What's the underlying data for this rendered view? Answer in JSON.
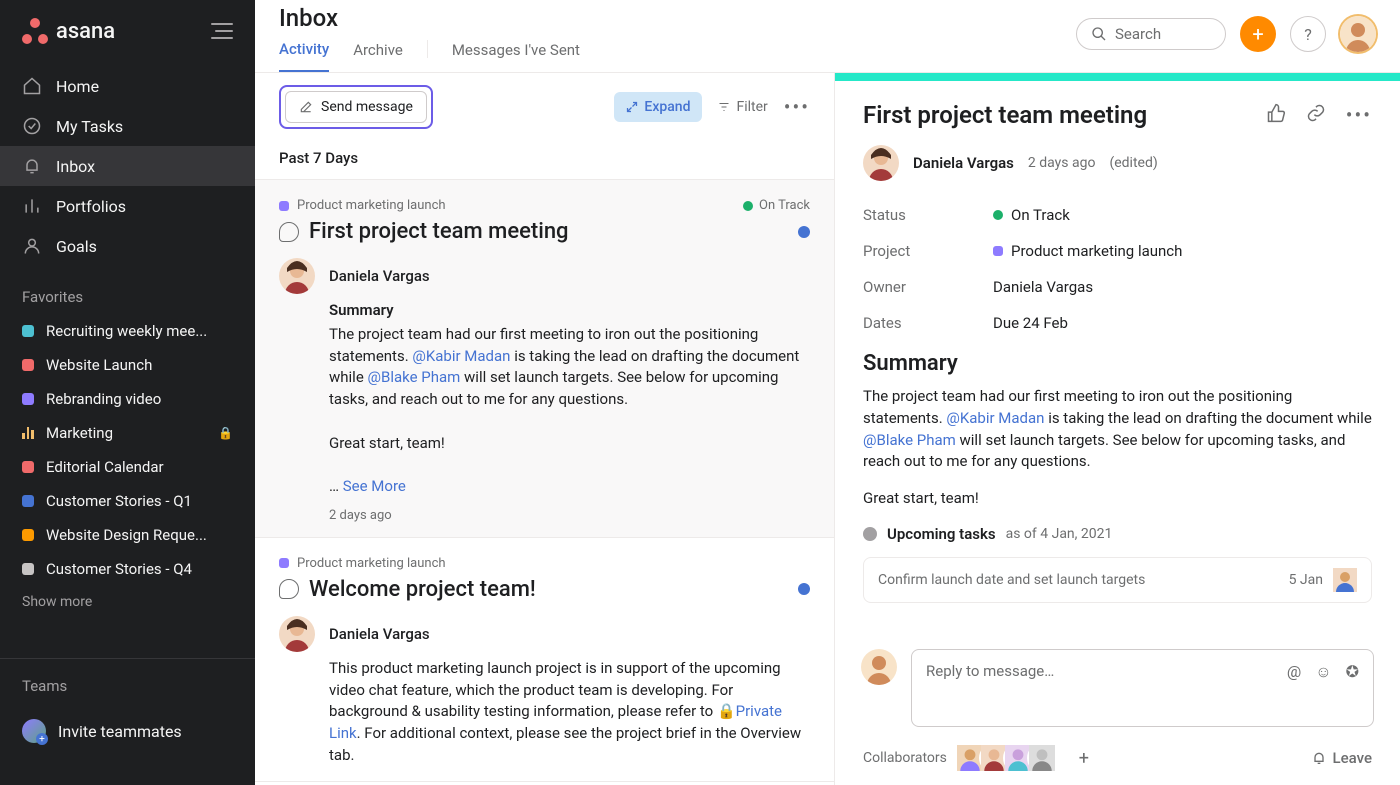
{
  "app": {
    "name": "asana",
    "page_title": "Inbox"
  },
  "search": {
    "placeholder": "Search"
  },
  "nav": {
    "items": [
      {
        "label": "Home"
      },
      {
        "label": "My Tasks"
      },
      {
        "label": "Inbox"
      },
      {
        "label": "Portfolios"
      },
      {
        "label": "Goals"
      }
    ]
  },
  "favorites": {
    "heading": "Favorites",
    "items": [
      {
        "label": "Recruiting weekly mee...",
        "color": "#4dc0d1"
      },
      {
        "label": "Website Launch",
        "color": "#f06a6a"
      },
      {
        "label": "Rebranding video",
        "color": "#8e7bff"
      },
      {
        "label": "Marketing",
        "color": "bars",
        "locked": true
      },
      {
        "label": "Editorial Calendar",
        "color": "#f06a6a"
      },
      {
        "label": "Customer Stories - Q1",
        "color": "#4573d2"
      },
      {
        "label": "Website Design Reque...",
        "color": "#fd9a00"
      },
      {
        "label": "Customer Stories - Q4",
        "color": "#c7c4c4"
      }
    ],
    "show_more": "Show more"
  },
  "teams": {
    "heading": "Teams",
    "invite": "Invite teammates"
  },
  "tabs": {
    "activity": "Activity",
    "archive": "Archive",
    "sent": "Messages I've Sent"
  },
  "toolbar": {
    "send": "Send message",
    "expand": "Expand",
    "filter": "Filter"
  },
  "range": "Past 7 Days",
  "colors": {
    "purple": "#8e7bff",
    "green": "#1cb06a"
  },
  "inbox": [
    {
      "project": "Product marketing launch",
      "status": "On Track",
      "title": "First project team meeting",
      "author": "Daniela Vargas",
      "summary_heading": "Summary",
      "body_a": "The project team had our first meeting to iron out the positioning statements. ",
      "mention1": "@Kabir Madan",
      "body_b": " is taking the lead on drafting the document while ",
      "mention2": "@Blake Pham",
      "body_c": " will set launch targets. See below for upcoming tasks, and reach out to me for any questions.",
      "closing": "Great start, team!",
      "ellipsis": "… ",
      "see_more": "See More",
      "time": "2 days ago"
    },
    {
      "project": "Product marketing launch",
      "title": "Welcome project team!",
      "author": "Daniela Vargas",
      "body_a": "This product marketing launch project is in support of the upcoming video chat feature, which the product team is developing. For background & usability testing information, please refer to ",
      "link1": "Private Link",
      "body_b": ". For additional context, please see the project brief in the Overview tab."
    }
  ],
  "detail": {
    "title": "First project team meeting",
    "author": "Daniela Vargas",
    "time": "2 days ago",
    "edited": "(edited)",
    "fields": {
      "status_label": "Status",
      "status_val": "On Track",
      "project_label": "Project",
      "project_val": "Product marketing launch",
      "owner_label": "Owner",
      "owner_val": "Daniela Vargas",
      "dates_label": "Dates",
      "dates_val": "Due 24 Feb"
    },
    "summary_heading": "Summary",
    "body_a": "The project team had our first meeting to iron out the positioning statements. ",
    "mention1": "@Kabir Madan",
    "body_b": " is taking the lead on drafting the document while ",
    "mention2": "@Blake Pham",
    "body_c": " will set launch targets. See below for upcoming tasks, and reach out to me for any questions.",
    "closing": "Great start, team!",
    "upcoming_title": "Upcoming tasks",
    "upcoming_meta": "as of 4 Jan, 2021",
    "task": {
      "title": "Confirm launch date and set launch targets",
      "due": "5 Jan"
    },
    "reply_placeholder": "Reply to message…",
    "collaborators_label": "Collaborators",
    "leave": "Leave"
  }
}
